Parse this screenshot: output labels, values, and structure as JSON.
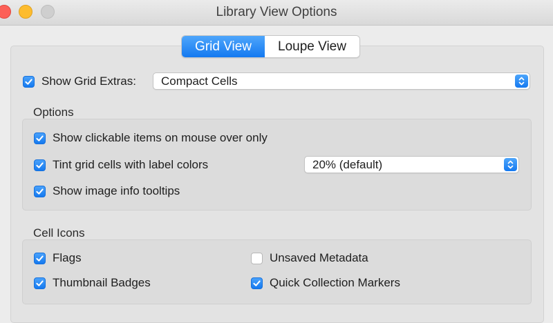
{
  "window": {
    "title": "Library View Options"
  },
  "tabs": [
    {
      "label": "Grid View",
      "active": true
    },
    {
      "label": "Loupe View",
      "active": false
    }
  ],
  "grid_extras": {
    "checkbox_label": "Show Grid Extras:",
    "checked": true,
    "selected": "Compact Cells"
  },
  "options": {
    "title": "Options",
    "show_clickable": {
      "label": "Show clickable items on mouse over only",
      "checked": true
    },
    "tint_cells": {
      "label": "Tint grid cells with label colors",
      "checked": true,
      "selected": "20% (default)"
    },
    "image_tooltips": {
      "label": "Show image info tooltips",
      "checked": true
    }
  },
  "cell_icons": {
    "title": "Cell Icons",
    "flags": {
      "label": "Flags",
      "checked": true
    },
    "unsaved_metadata": {
      "label": "Unsaved Metadata",
      "checked": false
    },
    "thumbnail_badges": {
      "label": "Thumbnail Badges",
      "checked": true
    },
    "quick_collection": {
      "label": "Quick Collection Markers",
      "checked": true
    }
  },
  "colors": {
    "accent": "#1479f0",
    "window_bg": "#ececec"
  }
}
